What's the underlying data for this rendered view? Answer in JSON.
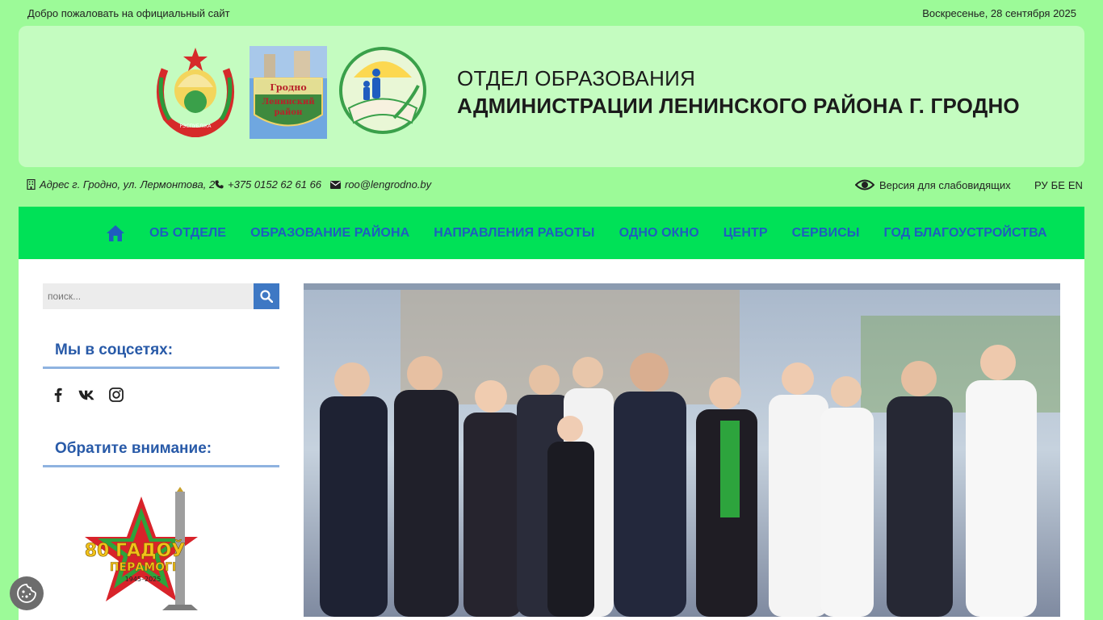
{
  "topbar": {
    "welcome": "Добро пожаловать на официальный сайт",
    "date": "Воскресенье, 28 сентября 2025"
  },
  "header": {
    "title_line1": "ОТДЕЛ ОБРАЗОВАНИЯ",
    "title_line2": "АДМИНИСТРАЦИИ ЛЕНИНСКОГО РАЙОНА Г. ГРОДНО",
    "emblem_by_text": "РЭСПУБЛІКА БЕЛАРУСЬ",
    "emblem_grodno_text": "Гродно Ленинский район"
  },
  "contacts": {
    "address": "Адрес г. Гродно, ул. Лермонтова, 2",
    "phone": "+375 0152 62 61 66",
    "email": "roo@lengrodno.by",
    "vision": "Версия для слабовидящих",
    "langs": [
      "РУ",
      "БЕ",
      "EN"
    ]
  },
  "nav": {
    "items": [
      "ОБ ОТДЕЛЕ",
      "ОБРАЗОВАНИЕ РАЙОНА",
      "НАПРАВЛЕНИЯ РАБОТЫ",
      "ОДНО ОКНО",
      "ЦЕНТР",
      "СЕРВИСЫ",
      "ГОД БЛАГОУСТРОЙСТВА"
    ]
  },
  "sidebar": {
    "search_placeholder": "поиск...",
    "social_title": "Мы в соцсетях:",
    "attention_title": "Обратите внимание:",
    "banner_text": "80 ГАДОЎ ПЕРАМОГІ",
    "banner_years": "1945–2025"
  },
  "colors": {
    "page_bg": "#9cfa98",
    "header_bg": "#c4fcc0",
    "nav_bg": "#00e157",
    "nav_text": "#1f5dbf",
    "accent": "#3e78c4"
  },
  "icons": [
    "building-icon",
    "phone-icon",
    "envelope-icon",
    "eye-icon",
    "home-icon",
    "search-icon",
    "facebook-icon",
    "vk-icon",
    "instagram-icon",
    "cookie-icon"
  ]
}
